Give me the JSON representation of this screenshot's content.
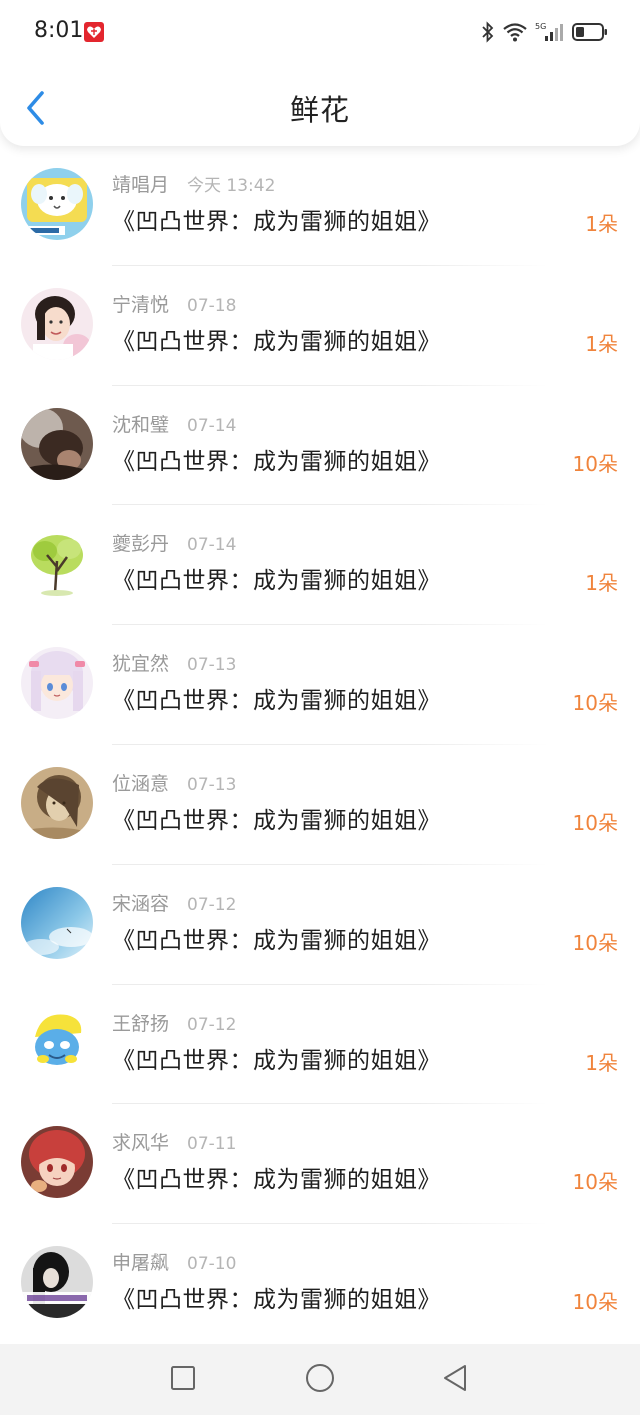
{
  "status_bar": {
    "time": "8:01",
    "app_icon": "red-heart-badge-icon",
    "icons": [
      "bluetooth-icon",
      "wifi-icon",
      "5g-signal-icon",
      "battery-icon"
    ],
    "network_label": "5G"
  },
  "header": {
    "title": "鲜花",
    "back_icon": "chevron-left-icon",
    "accent_color": "#2e8ce6"
  },
  "list": {
    "amount_color": "#f0843c",
    "items": [
      {
        "name": "靖唱月",
        "date": "今天 13:42",
        "book": "《凹凸世界：成为雷狮的姐姐》",
        "amount": "1朵",
        "avatar": "cartoon-elephant-avatar"
      },
      {
        "name": "宁清悦",
        "date": "07-18",
        "book": "《凹凸世界：成为雷狮的姐姐》",
        "amount": "1朵",
        "avatar": "girl-photo-avatar"
      },
      {
        "name": "沈和璧",
        "date": "07-14",
        "book": "《凹凸世界：成为雷狮的姐姐》",
        "amount": "10朵",
        "avatar": "dark-portrait-avatar"
      },
      {
        "name": "夔彭丹",
        "date": "07-14",
        "book": "《凹凸世界：成为雷狮的姐姐》",
        "amount": "1朵",
        "avatar": "green-tree-avatar"
      },
      {
        "name": "犹宜然",
        "date": "07-13",
        "book": "《凹凸世界：成为雷狮的姐姐》",
        "amount": "10朵",
        "avatar": "anime-girl-avatar"
      },
      {
        "name": "位涵意",
        "date": "07-13",
        "book": "《凹凸世界：成为雷狮的姐姐》",
        "amount": "10朵",
        "avatar": "sketch-girl-avatar"
      },
      {
        "name": "宋涵容",
        "date": "07-12",
        "book": "《凹凸世界：成为雷狮的姐姐》",
        "amount": "10朵",
        "avatar": "blue-sky-avatar"
      },
      {
        "name": "王舒扬",
        "date": "07-12",
        "book": "《凹凸世界：成为雷狮的姐姐》",
        "amount": "1朵",
        "avatar": "smurf-avatar"
      },
      {
        "name": "求风华",
        "date": "07-11",
        "book": "《凹凸世界：成为雷狮的姐姐》",
        "amount": "10朵",
        "avatar": "red-hair-anime-avatar"
      },
      {
        "name": "申屠飙",
        "date": "07-10",
        "book": "《凹凸世界：成为雷狮的姐姐》",
        "amount": "10朵",
        "avatar": "dark-photo-avatar"
      }
    ]
  },
  "nav_bar": {
    "buttons": [
      "recents-square-icon",
      "home-circle-icon",
      "back-triangle-icon"
    ]
  }
}
